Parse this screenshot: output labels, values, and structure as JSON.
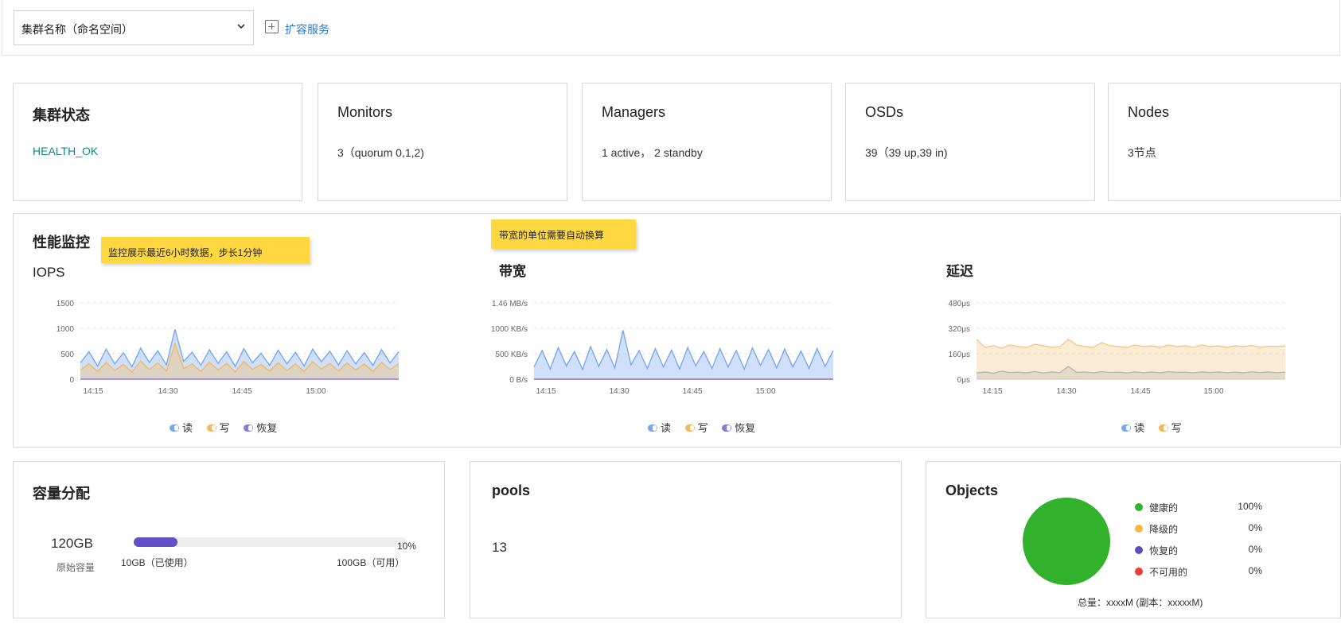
{
  "header": {
    "cluster_select": "集群名称（命名空间）",
    "expand_label": "扩容服务"
  },
  "status_cards": [
    {
      "title": "集群状态",
      "value": "HEALTH_OK"
    },
    {
      "title": "Monitors",
      "value": "3（quorum 0,1,2)"
    },
    {
      "title": "Managers",
      "value": "1 active， 2 standby"
    },
    {
      "title": "OSDs",
      "value": "39（39 up,39 in)"
    },
    {
      "title": "Nodes",
      "value": "3节点"
    }
  ],
  "perf": {
    "title": "性能监控",
    "note_monitor": "监控展示最近6小时数据，步长1分钟",
    "note_bandwidth": "带宽的单位需要自动换算"
  },
  "chart_data": [
    {
      "type": "area",
      "title": "IOPS",
      "yticks": [
        "1500",
        "1000",
        "500",
        "0"
      ],
      "ylim": [
        0,
        1500
      ],
      "xticks": [
        "14:15",
        "14:30",
        "14:45",
        "15:00"
      ],
      "series": [
        {
          "name": "读",
          "color": "#7aa7f0",
          "values": [
            320,
            540,
            260,
            590,
            300,
            520,
            240,
            610,
            330,
            560,
            280,
            980,
            350,
            530,
            270,
            580,
            310,
            540,
            250,
            600,
            320,
            510,
            270,
            570,
            300,
            530,
            260,
            590,
            340,
            550,
            280,
            560,
            300,
            520,
            270,
            580,
            320,
            540
          ]
        },
        {
          "name": "写",
          "color": "#f4b95a",
          "values": [
            180,
            300,
            150,
            330,
            170,
            290,
            140,
            360,
            190,
            320,
            160,
            700,
            210,
            300,
            150,
            330,
            180,
            310,
            140,
            350,
            190,
            290,
            160,
            320,
            170,
            300,
            150,
            340,
            200,
            310,
            160,
            320,
            180,
            300,
            150,
            330,
            190,
            300
          ]
        },
        {
          "name": "恢复",
          "color": "#8c7ad8",
          "values": [
            0,
            0,
            0,
            0,
            0,
            0,
            0,
            0,
            0,
            0,
            0,
            0,
            0,
            0,
            0,
            0,
            0,
            0,
            0,
            0,
            0,
            0,
            0,
            0,
            0,
            0,
            0,
            0,
            0,
            0,
            0,
            0,
            0,
            0,
            0,
            0,
            0,
            0
          ]
        }
      ]
    },
    {
      "type": "area",
      "title": "带宽",
      "yticks": [
        "1.46 MB/s",
        "1000 KB/s",
        "500 KB/s",
        "0 B/s"
      ],
      "ylim": [
        0,
        1495
      ],
      "xticks": [
        "14:15",
        "14:30",
        "14:45",
        "15:00"
      ],
      "series": [
        {
          "name": "读",
          "color": "#7aa7f0",
          "values": [
            240,
            560,
            200,
            620,
            260,
            540,
            190,
            640,
            250,
            580,
            220,
            960,
            280,
            560,
            210,
            600,
            240,
            570,
            200,
            620,
            260,
            540,
            210,
            600,
            240,
            560,
            200,
            610,
            270,
            580,
            220,
            590,
            240,
            550,
            210,
            600,
            250,
            560
          ]
        },
        {
          "name": "写",
          "color": "#f4b95a",
          "values": [
            0,
            0,
            0,
            0,
            0,
            0,
            0,
            0,
            0,
            0,
            0,
            0,
            0,
            0,
            0,
            0,
            0,
            0,
            0,
            0,
            0,
            0,
            0,
            0,
            0,
            0,
            0,
            0,
            0,
            0,
            0,
            0,
            0,
            0,
            0,
            0,
            0,
            0
          ]
        },
        {
          "name": "恢复",
          "color": "#8c7ad8",
          "values": [
            0,
            0,
            0,
            0,
            0,
            0,
            0,
            0,
            0,
            0,
            0,
            0,
            0,
            0,
            0,
            0,
            0,
            0,
            0,
            0,
            0,
            0,
            0,
            0,
            0,
            0,
            0,
            0,
            0,
            0,
            0,
            0,
            0,
            0,
            0,
            0,
            0,
            0
          ]
        }
      ]
    },
    {
      "type": "area",
      "title": "延迟",
      "yticks": [
        "480μs",
        "320μs",
        "160μs",
        "0μs"
      ],
      "ylim": [
        0,
        480
      ],
      "xticks": [
        "14:15",
        "14:30",
        "14:45",
        "15:00"
      ],
      "series": [
        {
          "name": "读",
          "color": "#97aecb",
          "values": [
            40,
            45,
            38,
            50,
            42,
            44,
            40,
            48,
            39,
            46,
            41,
            80,
            43,
            45,
            40,
            47,
            42,
            44,
            39,
            46,
            41,
            45,
            40,
            47,
            43,
            44,
            40,
            46,
            42,
            45,
            41,
            44,
            40,
            46,
            42,
            45,
            41,
            44
          ]
        },
        {
          "name": "写",
          "color": "#f4c987",
          "values": [
            250,
            200,
            210,
            195,
            215,
            205,
            200,
            220,
            210,
            200,
            205,
            250,
            215,
            205,
            200,
            230,
            210,
            205,
            200,
            215,
            205,
            210,
            200,
            215,
            205,
            210,
            200,
            215,
            205,
            210,
            200,
            210,
            205,
            212,
            200,
            208,
            205,
            210
          ]
        }
      ]
    }
  ],
  "legend_labels": {
    "iops": [
      "读",
      "写",
      "恢复"
    ],
    "bandwidth": [
      "读",
      "写",
      "恢复"
    ],
    "latency": [
      "读",
      "写"
    ]
  },
  "capacity": {
    "title": "容量分配",
    "total": "120GB",
    "total_label": "原始容量",
    "used_percent": 10,
    "percent_text": "10%",
    "used_label": "10GB（已使用）",
    "available_label": "100GB（可用）"
  },
  "pools": {
    "title": "pools",
    "count": "13"
  },
  "objects": {
    "title": "Objects",
    "legend": [
      {
        "label": "健康的",
        "percent": "100%",
        "color": "#32b12c"
      },
      {
        "label": "降级的",
        "percent": "0%",
        "color": "#f6b73c"
      },
      {
        "label": "恢复的",
        "percent": "0%",
        "color": "#5b4bc4"
      },
      {
        "label": "不可用的",
        "percent": "0%",
        "color": "#ee3b3b"
      }
    ],
    "total_text": "总量：xxxxM (副本：xxxxxM)"
  }
}
